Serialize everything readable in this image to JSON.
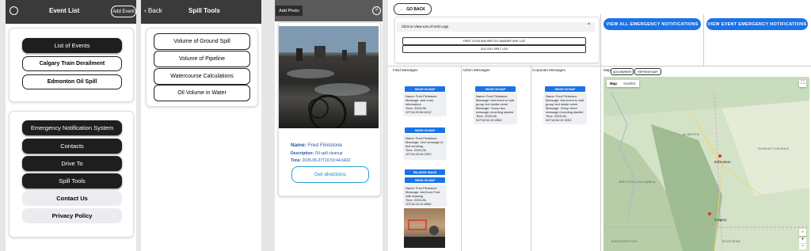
{
  "panel1": {
    "header_title": "Event List",
    "add_event": "Add Event",
    "events": [
      "List of Events",
      "Calgary Train Derailment",
      "Edmonton Oil Spill"
    ],
    "menu": [
      "Emergency Notification System",
      "Contacts",
      "Drive To",
      "Spill Tools",
      "Contact Us",
      "Privacy Policy"
    ]
  },
  "panel2": {
    "back": "Back",
    "title": "Spill Tools",
    "tools": [
      "Volume of Ground Spill",
      "Volume of Pipeline",
      "Watercourse Calculations",
      "Oil Volume in Water"
    ]
  },
  "panel3": {
    "add_photo": "Add Photo",
    "name_label": "Name:",
    "name_value": "Fred Flintstone",
    "desc_label": "Description:",
    "desc_value": "Oil spill cleanup",
    "time_label": "Time:",
    "time_value": "2025-05-27T16:53:44.643Z",
    "directions": "Get directions"
  },
  "dashboard": {
    "go_back": "GO BACK",
    "unit_logs_header": "Click to View List of Unit Logs",
    "log_buttons": [
      "FIRST COOK AND BRITTLE WASHER UNIT LOG",
      "OLD GUY SPILT LOG"
    ],
    "view_all_notifications": "VIEW ALL EMERGENCY NOTIFICATIONS",
    "view_event_notifications": "VIEW EVENT EMERGENCY NOTIFICATIONS",
    "columns": {
      "field": "Field Messages",
      "admin": "Admin Messages",
      "corporate": "Corporate Messages",
      "map": "Map"
    },
    "show_on_map": "SHOW ON MAP",
    "enlarge_image": "ENLARGE IMAGE",
    "add_marker": "ADD MARKER",
    "refresh_map": "REFRESH MAP",
    "map_tabs": [
      "Map",
      "Satellite"
    ],
    "field_messages": [
      {
        "name": "Name: Fred Flintstone",
        "message": "Message: add more information",
        "time": "Time: 2025-06-10T16:20:56.641Z"
      },
      {
        "name": "Name: Fred Flintstone",
        "message": "Message: new message to test scrolling",
        "time": "Time: 2025-06-10T16:25:08.232Z"
      },
      {
        "name": "Name: Fred Flintstone",
        "message": "Message: test from Fred with drawing",
        "time": "Time: 2025-06-10T16:23:10.858Z"
      }
    ],
    "admin_messages": [
      {
        "name": "Name: Fred Flintstone",
        "message": "Message: test event to add group text inside event Message: Group two message recording started",
        "time": "Time: 2025-06-04T16:54:19.258Z"
      }
    ],
    "corporate_messages": [
      {
        "name": "Name: Fred Flintstone",
        "message": "Message: test event to add group text inside event Message: Group three message recording started",
        "time": "Time: 2025-06-04T16:54:19.329Z"
      }
    ],
    "map_labels": [
      "ALBERTA",
      "SASKATCHEWAN",
      "BRITISH COLUMBIA",
      "Edmonton",
      "Calgary",
      "WASHINGTON",
      "MONTANA"
    ]
  }
}
